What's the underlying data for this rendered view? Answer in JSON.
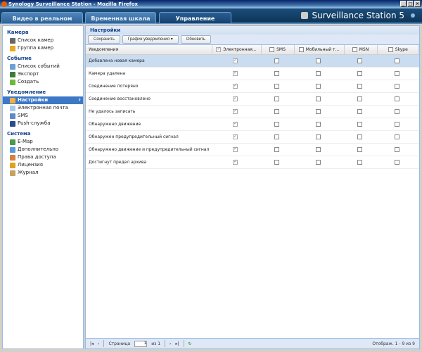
{
  "window": {
    "title": "Synology Surveillance Station - Mozilla Firefox",
    "buttons": [
      "_",
      "□",
      "×"
    ]
  },
  "tabs": [
    {
      "label": "Видео в реальном времени"
    },
    {
      "label": "Временная шкала"
    },
    {
      "label": "Управление"
    }
  ],
  "brand": "Surveillance Station 5",
  "sidebar": [
    {
      "title": "Камера",
      "items": [
        {
          "label": "Список камер",
          "icon": "camera-icon",
          "color": "#666"
        },
        {
          "label": "Группа камер",
          "icon": "camera-group-icon",
          "color": "#e8a820"
        }
      ]
    },
    {
      "title": "Событие",
      "items": [
        {
          "label": "Список событий",
          "icon": "event-list-icon",
          "color": "#6aa0d8"
        },
        {
          "label": "Экспорт",
          "icon": "export-icon",
          "color": "#3a7a3a"
        },
        {
          "label": "Создать",
          "icon": "create-icon",
          "color": "#6cba3c"
        }
      ]
    },
    {
      "title": "Уведомление",
      "items": [
        {
          "label": "Настройки",
          "icon": "wrench-icon",
          "color": "#f0b040"
        },
        {
          "label": "Электронная почта",
          "icon": "email-icon",
          "color": "#a8c8e8"
        },
        {
          "label": "SMS",
          "icon": "sms-icon",
          "color": "#5a8ac8"
        },
        {
          "label": "Push-служба",
          "icon": "phone-icon",
          "color": "#2a4a8a"
        }
      ]
    },
    {
      "title": "Система",
      "items": [
        {
          "label": "E-Map",
          "icon": "map-icon",
          "color": "#4a9a4a"
        },
        {
          "label": "Дополнительно",
          "icon": "advanced-icon",
          "color": "#5a9ad8"
        },
        {
          "label": "Права доступа",
          "icon": "users-icon",
          "color": "#d88040"
        },
        {
          "label": "Лицензия",
          "icon": "key-icon",
          "color": "#e0a020"
        },
        {
          "label": "Журнал",
          "icon": "log-icon",
          "color": "#c8a060"
        }
      ]
    }
  ],
  "panel": {
    "title": "Настройки",
    "save": "Сохранить",
    "schedule": "График уведомления",
    "refresh": "Обновить"
  },
  "columns": [
    "Уведомления",
    "Электронная...",
    "SMS",
    "Мобильный т...",
    "MSN",
    "Skype"
  ],
  "rows": [
    {
      "label": "Добавлена новая камера",
      "email": true
    },
    {
      "label": "Камера удалена",
      "email": true
    },
    {
      "label": "Соединение потеряно",
      "email": true
    },
    {
      "label": "Соединение восстановлено",
      "email": true
    },
    {
      "label": "Не удалось записать",
      "email": true
    },
    {
      "label": "Обнаружено движение",
      "email": true
    },
    {
      "label": "Обнаружен предупредительный сигнал",
      "email": true
    },
    {
      "label": "Обнаружено движение и предупредительный сигнал",
      "email": true
    },
    {
      "label": "Достигнут предел архива",
      "email": true
    }
  ],
  "pager": {
    "page_label": "Страница",
    "page": "1",
    "of": "из 1",
    "info": "Отображ. 1 - 9 из 9"
  }
}
